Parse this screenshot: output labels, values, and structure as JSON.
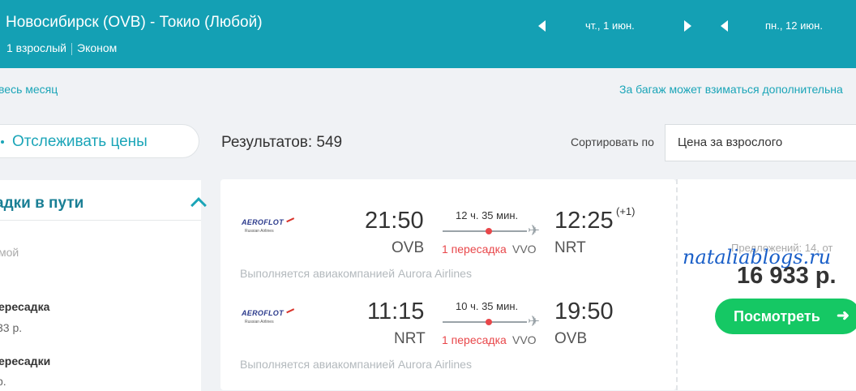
{
  "header": {
    "route": "Новосибирск (OVB) - Токио (Любой)",
    "passengers": "1 взрослый",
    "cabin": "Эконом",
    "depart_date": "чт., 1 июн.",
    "return_date": "пн., 12 июн."
  },
  "links": {
    "whole_month": "весь месяц",
    "baggage_note": "За багаж может взиматься дополнительна"
  },
  "sidebar": {
    "track_label": "Отслеживать цены",
    "stops_title": "адки в пути",
    "options": [
      {
        "label": "мой",
        "price": ""
      },
      {
        "label": "ересадка",
        "price": "33 р."
      },
      {
        "label": "ересадки",
        "price": "р."
      }
    ]
  },
  "results": {
    "count_text": "Результатов: 549",
    "sort_label": "Сортировать по",
    "sort_value": "Цена за взрослого"
  },
  "ticket": {
    "legs": [
      {
        "depart_time": "21:50",
        "depart_code": "OVB",
        "duration": "12 ч. 35 мин.",
        "stops": "1 пересадка",
        "via": "VVO",
        "arrive_time": "12:25",
        "day_offset": "(+1)",
        "arrive_code": "NRT",
        "operator": "Выполняется авиакомпанией Aurora Airlines"
      },
      {
        "depart_time": "11:15",
        "depart_code": "NRT",
        "duration": "10 ч. 35 мин.",
        "stops": "1 пересадка",
        "via": "VVO",
        "arrive_time": "19:50",
        "day_offset": "",
        "arrive_code": "OVB",
        "operator": "Выполняется авиакомпанией Aurora Airlines"
      }
    ],
    "airline_logo_text": "AEROFLOT",
    "airline_logo_sub": "Russian Airlines",
    "offers": "Предложений: 14, от",
    "price": "16 933 р.",
    "view_button": "Посмотреть",
    "watermark": "nataliablogs.ru"
  },
  "colors": {
    "header_bg": "#14a0b4",
    "accent": "#1ba5b8",
    "button_green": "#15c864",
    "stop_red": "#e8474a"
  }
}
